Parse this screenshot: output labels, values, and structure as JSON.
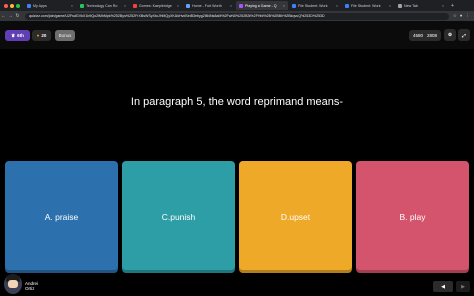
{
  "browser": {
    "tabs": [
      {
        "label": "My Apps",
        "color": "#3b82f6",
        "active": false
      },
      {
        "label": "Technology Can Ro",
        "color": "#22c55e",
        "active": false
      },
      {
        "label": "Gomes: Kaeplbridge",
        "color": "#ef4444",
        "active": false
      },
      {
        "label": "Home - Fort Worth",
        "color": "#60a5fa",
        "active": false
      },
      {
        "label": "Playing a Game - Q",
        "color": "#a855f7",
        "active": true
      },
      {
        "label": "File Student: Work",
        "color": "#3b82f6",
        "active": false
      },
      {
        "label": "File Student: Work",
        "color": "#3b82f6",
        "active": false
      },
      {
        "label": "New Tab",
        "color": "#9ca3af",
        "active": false
      }
    ],
    "url": "quizizz.com/join/game/U2FsdGVkX1b9Qo2lMhMpk%252Bys%252FrXBsWSyXtoJHMQyXKAkHvdSeiB3ebyg2iB4Ns8aM%2FwN0%252B3t%2FHbI%2B%2BBh%2BkqvuQ%253D%253D"
  },
  "quizbar": {
    "grade_label": "6th",
    "streak_count": "20",
    "bonus_label": "Bonus",
    "score_a": "4580",
    "score_b": "2808"
  },
  "question": {
    "text": "In paragraph 5, the word reprimand means-"
  },
  "answers": [
    {
      "label": "A. praise"
    },
    {
      "label": "C.punish"
    },
    {
      "label": "D.upset"
    },
    {
      "label": "B. play"
    }
  ],
  "user": {
    "first_name": "Andrei",
    "last_name": "Ortiz"
  },
  "icons": [
    "back-arrow-icon",
    "forward-arrow-icon",
    "reload-icon",
    "star-icon",
    "settings-icon",
    "fullscreen-icon",
    "prev-icon",
    "next-icon"
  ]
}
